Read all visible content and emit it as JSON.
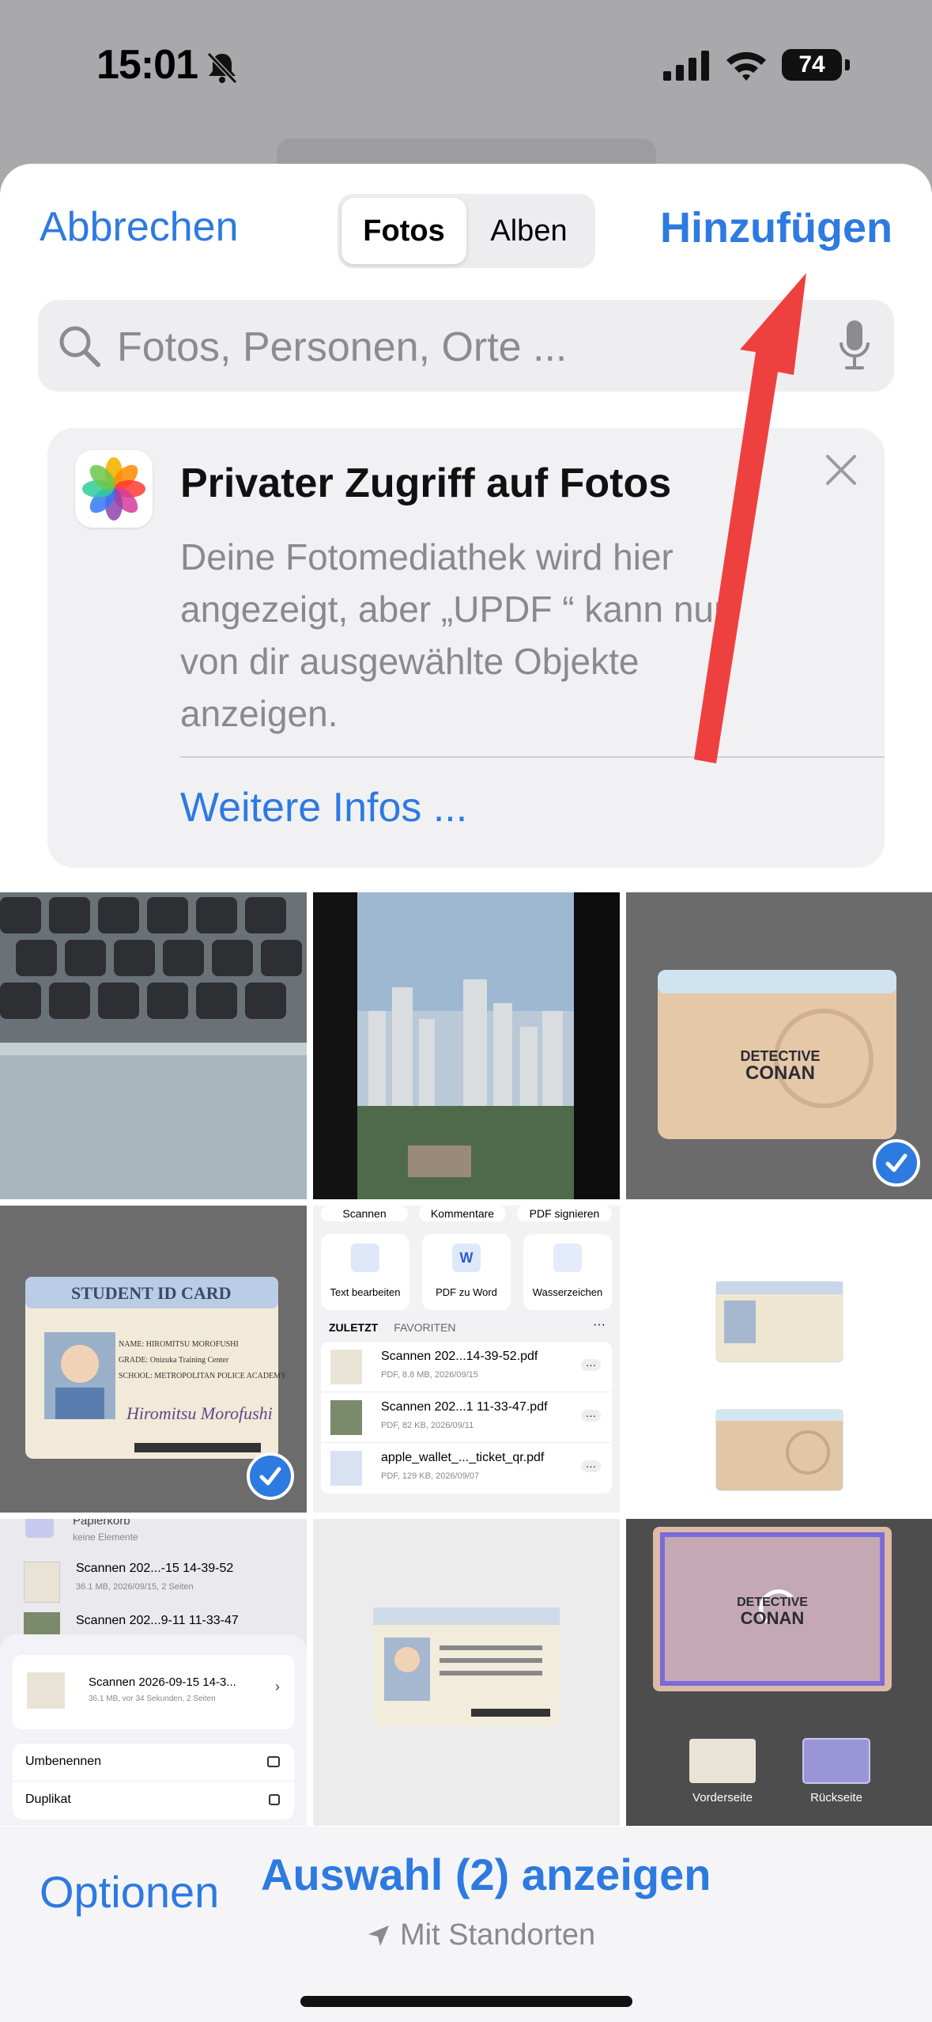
{
  "status_bar": {
    "time": "15:01",
    "battery": "74"
  },
  "nav": {
    "cancel": "Abbrechen",
    "add": "Hinzufügen",
    "tabs": [
      "Fotos",
      "Alben"
    ]
  },
  "search": {
    "placeholder": "Fotos, Personen, Orte ..."
  },
  "info_card": {
    "title": "Privater Zugriff auf Fotos",
    "body": "Deine Fotomediathek wird hier angezeigt, aber „UPDF “ kann nur von dir ausgewählte Objekte anzeigen.",
    "link": "Weitere Infos ..."
  },
  "grid": {
    "tile3": {
      "card_text_1": "DETECTIVE",
      "card_text_2": "CONAN",
      "selected": true
    },
    "tile4": {
      "card_title": "STUDENT ID CARD",
      "name_line": "NAME: HIROMITSU MOROFUSHI",
      "grade_line": "GRADE: Onizuka Training Center",
      "school_line": "SCHOOL: METROPOLITAN POLICE ACADEMY",
      "signature": "Hiromitsu Morofushi",
      "selected": true
    },
    "tile5": {
      "top_buttons": [
        "Scannen",
        "Kommentare",
        "PDF signieren"
      ],
      "tools": [
        "Text bearbeiten",
        "PDF zu Word",
        "Wasserzeichen"
      ],
      "tabs": [
        "ZULETZT",
        "FAVORITEN"
      ],
      "files": [
        {
          "name": "Scannen 202...14-39-52.pdf",
          "meta": "PDF, 8.8 MB, 2026/09/15"
        },
        {
          "name": "Scannen 202...1 11-33-47.pdf",
          "meta": "PDF, 82 KB, 2026/09/11"
        },
        {
          "name": "apple_wallet_..._ticket_qr.pdf",
          "meta": "PDF, 129 KB, 2026/09/07"
        }
      ]
    },
    "tile7": {
      "trash_label": "Papierkorb",
      "trash_meta": "keine Elemente",
      "rows": [
        {
          "name": "Scannen 202...-15 14-39-52",
          "meta": "36.1 MB, 2026/09/15, 2 Seiten"
        },
        {
          "name": "Scannen 202...9-11 11-33-47",
          "meta": ""
        }
      ],
      "sheet_file": {
        "name": "Scannen 2026-09-15 14-3...",
        "meta": "36.1 MB, vor 34 Sekunden, 2 Seiten"
      },
      "actions": [
        "Umbenennen",
        "Duplikat"
      ]
    },
    "tile9": {
      "front": "Vorderseite",
      "back": "Rückseite"
    }
  },
  "toolbar": {
    "options": "Optionen",
    "show_selection": "Auswahl (2) anzeigen",
    "location": "Mit Standorten"
  },
  "colors": {
    "accent": "#2d7ae0",
    "annotation_arrow": "#ef4040"
  }
}
